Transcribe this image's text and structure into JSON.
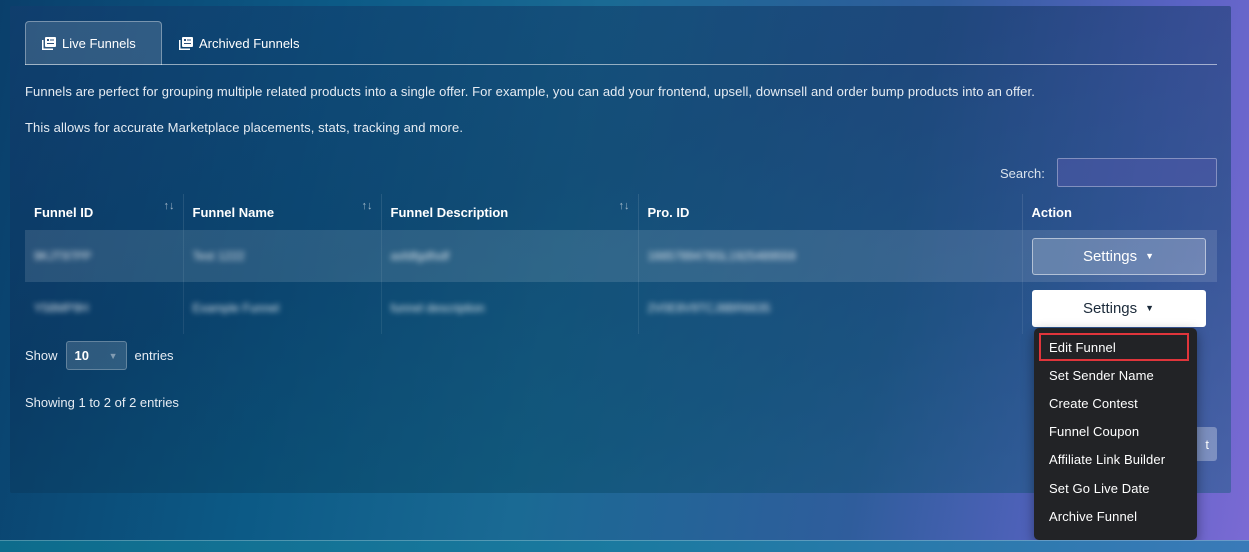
{
  "tabs": [
    {
      "label": "Live Funnels",
      "icon": "funnel-list-icon"
    },
    {
      "label": "Archived Funnels",
      "icon": "funnel-list-icon"
    }
  ],
  "description": {
    "line1": "Funnels are perfect for grouping multiple related products into a single offer. For example, you can add your frontend, upsell, downsell and order bump products into an offer.",
    "line2": "This allows for accurate Marketplace placements, stats, tracking and more."
  },
  "search": {
    "label": "Search:",
    "value": ""
  },
  "table": {
    "headers": [
      "Funnel ID",
      "Funnel Name",
      "Funnel Description",
      "Pro. ID",
      "Action"
    ],
    "rows": [
      {
        "id": "9KJT97PP",
        "name": "Test 1222",
        "description": "asfdfgdfsdf",
        "pro_id": "1665789478SL1925489559",
        "action": "Settings"
      },
      {
        "id": "Y58MP9H",
        "name": "Example Funnel",
        "description": "funnel description",
        "pro_id": "2V0E8V9TCJ8BR6635",
        "action": "Settings"
      }
    ]
  },
  "length_menu": {
    "show": "Show",
    "value": "10",
    "entries": "entries"
  },
  "info": "Showing 1 to 2 of 2 entries",
  "pagination": {
    "next_fragment": "t"
  },
  "dropdown_menu": [
    "Edit Funnel",
    "Set Sender Name",
    "Create Contest",
    "Funnel Coupon",
    "Affiliate Link Builder",
    "Set Go Live Date",
    "Archive Funnel"
  ],
  "colors": {
    "highlight_border": "#e0353b",
    "menu_bg": "#222326"
  }
}
